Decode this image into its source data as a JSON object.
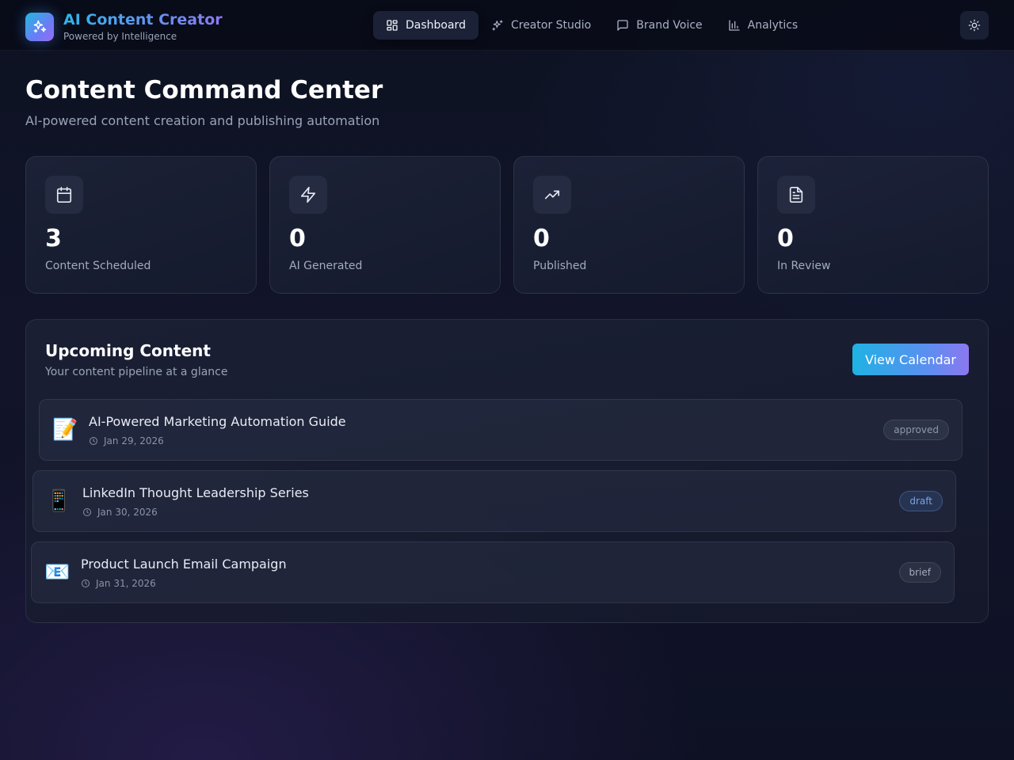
{
  "header": {
    "brand_title": "AI Content Creator",
    "brand_subtitle": "Powered by Intelligence",
    "nav": [
      {
        "label": "Dashboard",
        "icon": "dashboard-grid-icon",
        "active": true
      },
      {
        "label": "Creator Studio",
        "icon": "sparkles-icon",
        "active": false
      },
      {
        "label": "Brand Voice",
        "icon": "message-square-icon",
        "active": false
      },
      {
        "label": "Analytics",
        "icon": "bar-chart-icon",
        "active": false
      }
    ],
    "theme_toggle_icon": "sun-icon"
  },
  "page": {
    "title": "Content Command Center",
    "subtitle": "AI-powered content creation and publishing automation"
  },
  "stats": [
    {
      "value": "3",
      "label": "Content Scheduled",
      "icon": "calendar-icon"
    },
    {
      "value": "0",
      "label": "AI Generated",
      "icon": "lightning-icon"
    },
    {
      "value": "0",
      "label": "Published",
      "icon": "trending-up-icon"
    },
    {
      "value": "0",
      "label": "In Review",
      "icon": "document-icon"
    }
  ],
  "upcoming": {
    "title": "Upcoming Content",
    "subtitle": "Your content pipeline at a glance",
    "view_calendar_label": "View Calendar",
    "items": [
      {
        "emoji": "📝",
        "title": "AI-Powered Marketing Automation Guide",
        "date": "Jan 29, 2026",
        "status": "approved"
      },
      {
        "emoji": "📱",
        "title": "LinkedIn Thought Leadership Series",
        "date": "Jan 30, 2026",
        "status": "draft"
      },
      {
        "emoji": "📧",
        "title": "Product Launch Email Campaign",
        "date": "Jan 31, 2026",
        "status": "brief"
      }
    ]
  },
  "colors": {
    "accent_start": "#1fb2e4",
    "accent_end": "#8b78f0",
    "background": "#12152a"
  }
}
